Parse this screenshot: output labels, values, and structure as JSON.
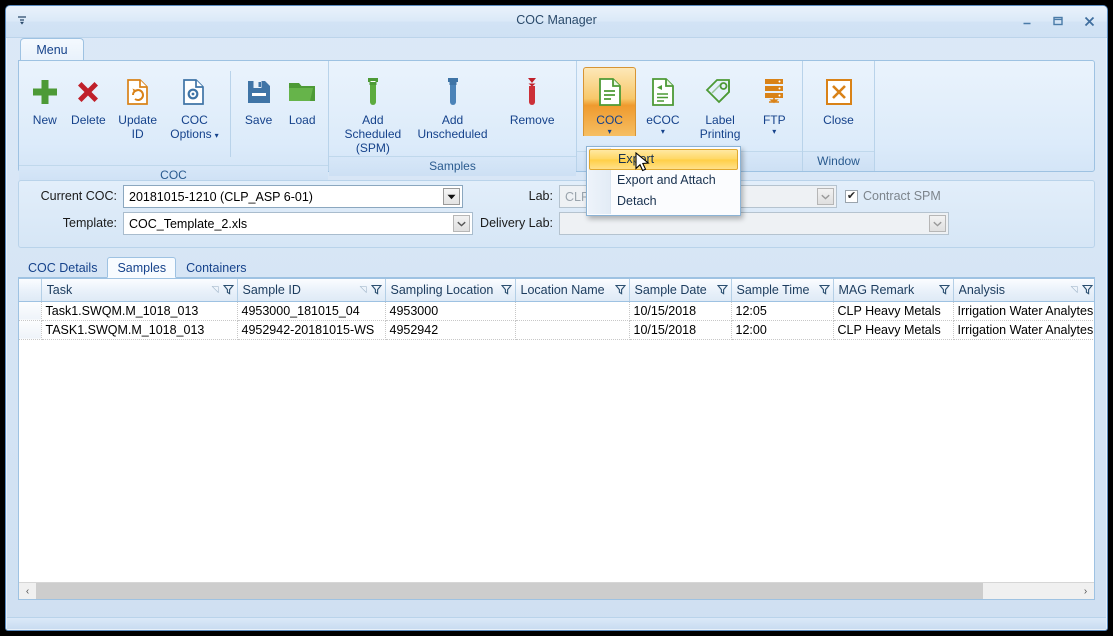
{
  "window": {
    "title": "COC Manager",
    "quick_access_icon": "customize-quick-access-icon",
    "minimize_label": "Minimize",
    "maximize_label": "Maximize",
    "close_label": "Close"
  },
  "ribbon": {
    "tab": "Menu",
    "groups": [
      {
        "name": "COC",
        "label": "COC",
        "buttons": [
          {
            "label": "New",
            "icon": "plus-icon",
            "caret": false
          },
          {
            "label": "Delete",
            "icon": "x-mark-icon",
            "caret": false
          },
          {
            "label": "Update\nID",
            "line1": "Update",
            "line2": "ID",
            "icon": "refresh-document-icon",
            "caret": false
          },
          {
            "label": "COC\nOptions",
            "line1": "COC",
            "line2": "Options",
            "icon": "gear-document-icon",
            "caret": true
          },
          {
            "label": "Save",
            "icon": "floppy-disk-icon",
            "caret": false
          },
          {
            "label": "Load",
            "icon": "folder-open-icon",
            "caret": false
          }
        ]
      },
      {
        "name": "Samples",
        "label": "Samples",
        "buttons": [
          {
            "line1": "Add Scheduled",
            "line2": "(SPM)",
            "icon": "green-test-tube-icon",
            "caret": false
          },
          {
            "line1": "Add",
            "line2": "Unscheduled",
            "icon": "blue-test-tube-icon",
            "caret": false
          },
          {
            "line1": "Remove",
            "line2": "",
            "icon": "red-test-tube-icon",
            "caret": false
          }
        ]
      },
      {
        "name": "Export",
        "label": "",
        "buttons": [
          {
            "line1": "COC",
            "line2": "",
            "icon": "green-document-icon",
            "caret": true,
            "active": true
          },
          {
            "line1": "eCOC",
            "line2": "",
            "icon": "green-document-arrow-icon",
            "caret": true
          },
          {
            "line1": "Label",
            "line2": "Printing",
            "icon": "tag-label-icon",
            "caret": false
          },
          {
            "line1": "FTP",
            "line2": "",
            "icon": "ftp-server-icon",
            "caret": true
          }
        ]
      },
      {
        "name": "Window",
        "label": "Window",
        "buttons": [
          {
            "line1": "Close",
            "line2": "",
            "icon": "close-x-box-icon",
            "caret": false
          }
        ]
      }
    ]
  },
  "dropdown_menu": {
    "visible": true,
    "items": [
      {
        "label": "Export",
        "selected": true
      },
      {
        "label": "Export and Attach",
        "selected": false
      },
      {
        "label": "Detach",
        "selected": false
      }
    ]
  },
  "form": {
    "current_coc_label": "Current COC:",
    "current_coc_value": "20181015-1210 (CLP_ASP 6-01)",
    "template_label": "Template:",
    "template_value": "COC_Template_2.xls",
    "lab_label": "Lab:",
    "lab_value": "CLP",
    "delivery_lab_label": "Delivery Lab:",
    "delivery_lab_value": "",
    "contract_spm_label": "Contract SPM",
    "contract_spm_checked": "✔"
  },
  "detail_tabs": [
    {
      "label": "COC Details",
      "active": false
    },
    {
      "label": "Samples",
      "active": true
    },
    {
      "label": "Containers",
      "active": false
    }
  ],
  "grid": {
    "columns": [
      {
        "label": "Task",
        "sortable": true
      },
      {
        "label": "Sample ID",
        "sortable": true
      },
      {
        "label": "Sampling Location",
        "sortable": false
      },
      {
        "label": "Location Name",
        "sortable": false
      },
      {
        "label": "Sample Date",
        "sortable": false
      },
      {
        "label": "Sample Time",
        "sortable": false
      },
      {
        "label": "MAG Remark",
        "sortable": false
      },
      {
        "label": "Analysis",
        "sortable": true
      }
    ],
    "rows": [
      {
        "task": "Task1.SWQM.M_1018_013",
        "sample_id": "4953000_181015_04",
        "sampling_location": "4953000",
        "location_name": "",
        "sample_date": "10/15/2018",
        "sample_time": "12:05",
        "mag_remark": "CLP Heavy Metals",
        "analysis": "Irrigation Water Analytes"
      },
      {
        "task": "TASK1.SWQM.M_1018_013",
        "sample_id": "4952942-20181015-WS",
        "sampling_location": "4952942",
        "location_name": "",
        "sample_date": "10/15/2018",
        "sample_time": "12:00",
        "mag_remark": "CLP Heavy Metals",
        "analysis": "Irrigation Water Analytes"
      }
    ]
  },
  "scrollbar": {
    "left_arrow": "‹",
    "right_arrow": "›"
  },
  "colors": {
    "accent_blue": "#15428b",
    "ribbon_active_orange": "#ef9a2e",
    "menu_highlight": "#ffd761",
    "icon_green": "#4d9a36",
    "icon_red": "#c0202a",
    "icon_orange": "#d98217",
    "icon_blue": "#3f74a6"
  }
}
